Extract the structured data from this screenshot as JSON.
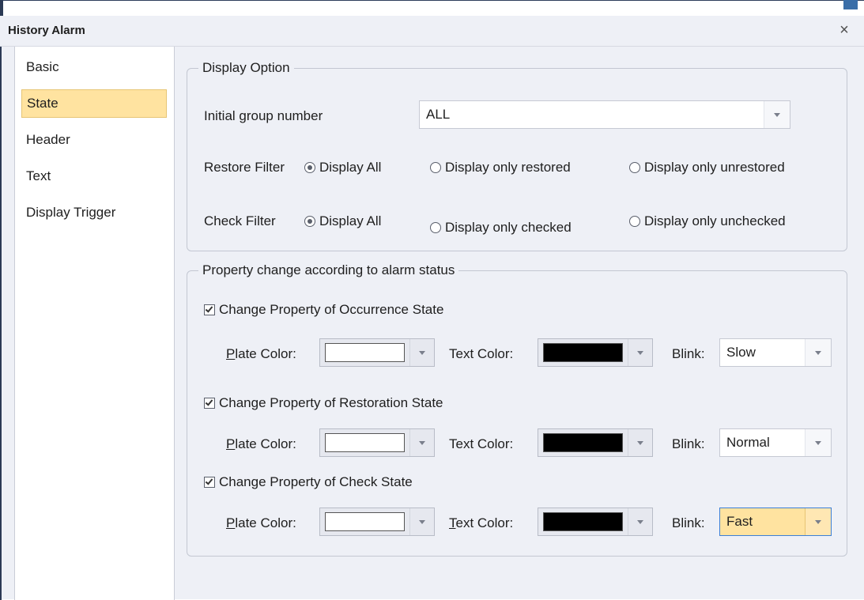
{
  "window": {
    "title": "History Alarm",
    "close_glyph": "×"
  },
  "nav": {
    "items": [
      {
        "label": "Basic"
      },
      {
        "label": "State"
      },
      {
        "label": "Header"
      },
      {
        "label": "Text"
      },
      {
        "label": "Display Trigger"
      }
    ],
    "selected": "State"
  },
  "display_option": {
    "legend": "Display Option",
    "initial_group_label": "Initial group number",
    "initial_group_value": "ALL",
    "restore_filter": {
      "label": "Restore Filter",
      "options": [
        "Display All",
        "Display only restored",
        "Display only unrestored"
      ],
      "selected": "Display All"
    },
    "check_filter": {
      "label": "Check Filter",
      "options": [
        "Display All",
        "Display only checked",
        "Display only unchecked"
      ],
      "selected": "Display All"
    }
  },
  "property_change": {
    "legend": "Property change according to alarm status",
    "plate_first_char": "P",
    "plate_rest": "late Color:",
    "text_first_char": "T",
    "text_rest": "ext Color:",
    "text_color_label": "Text Color:",
    "blink_label": "Blink:",
    "states": [
      {
        "label": "Change Property of Occurrence State",
        "checked": true,
        "plate_color": "#ffffff",
        "text_color": "#000000",
        "blink": "Slow"
      },
      {
        "label": "Change Property of Restoration State",
        "checked": true,
        "plate_color": "#ffffff",
        "text_color": "#000000",
        "blink": "Normal"
      },
      {
        "label": "Change Property of Check State",
        "checked": true,
        "plate_color": "#ffffff",
        "text_color": "#000000",
        "blink": "Fast"
      }
    ]
  },
  "colors": {
    "selection_highlight": "#ffe3a0",
    "focus_border": "#3c7fd6",
    "panel_bg": "#eef0f6"
  }
}
